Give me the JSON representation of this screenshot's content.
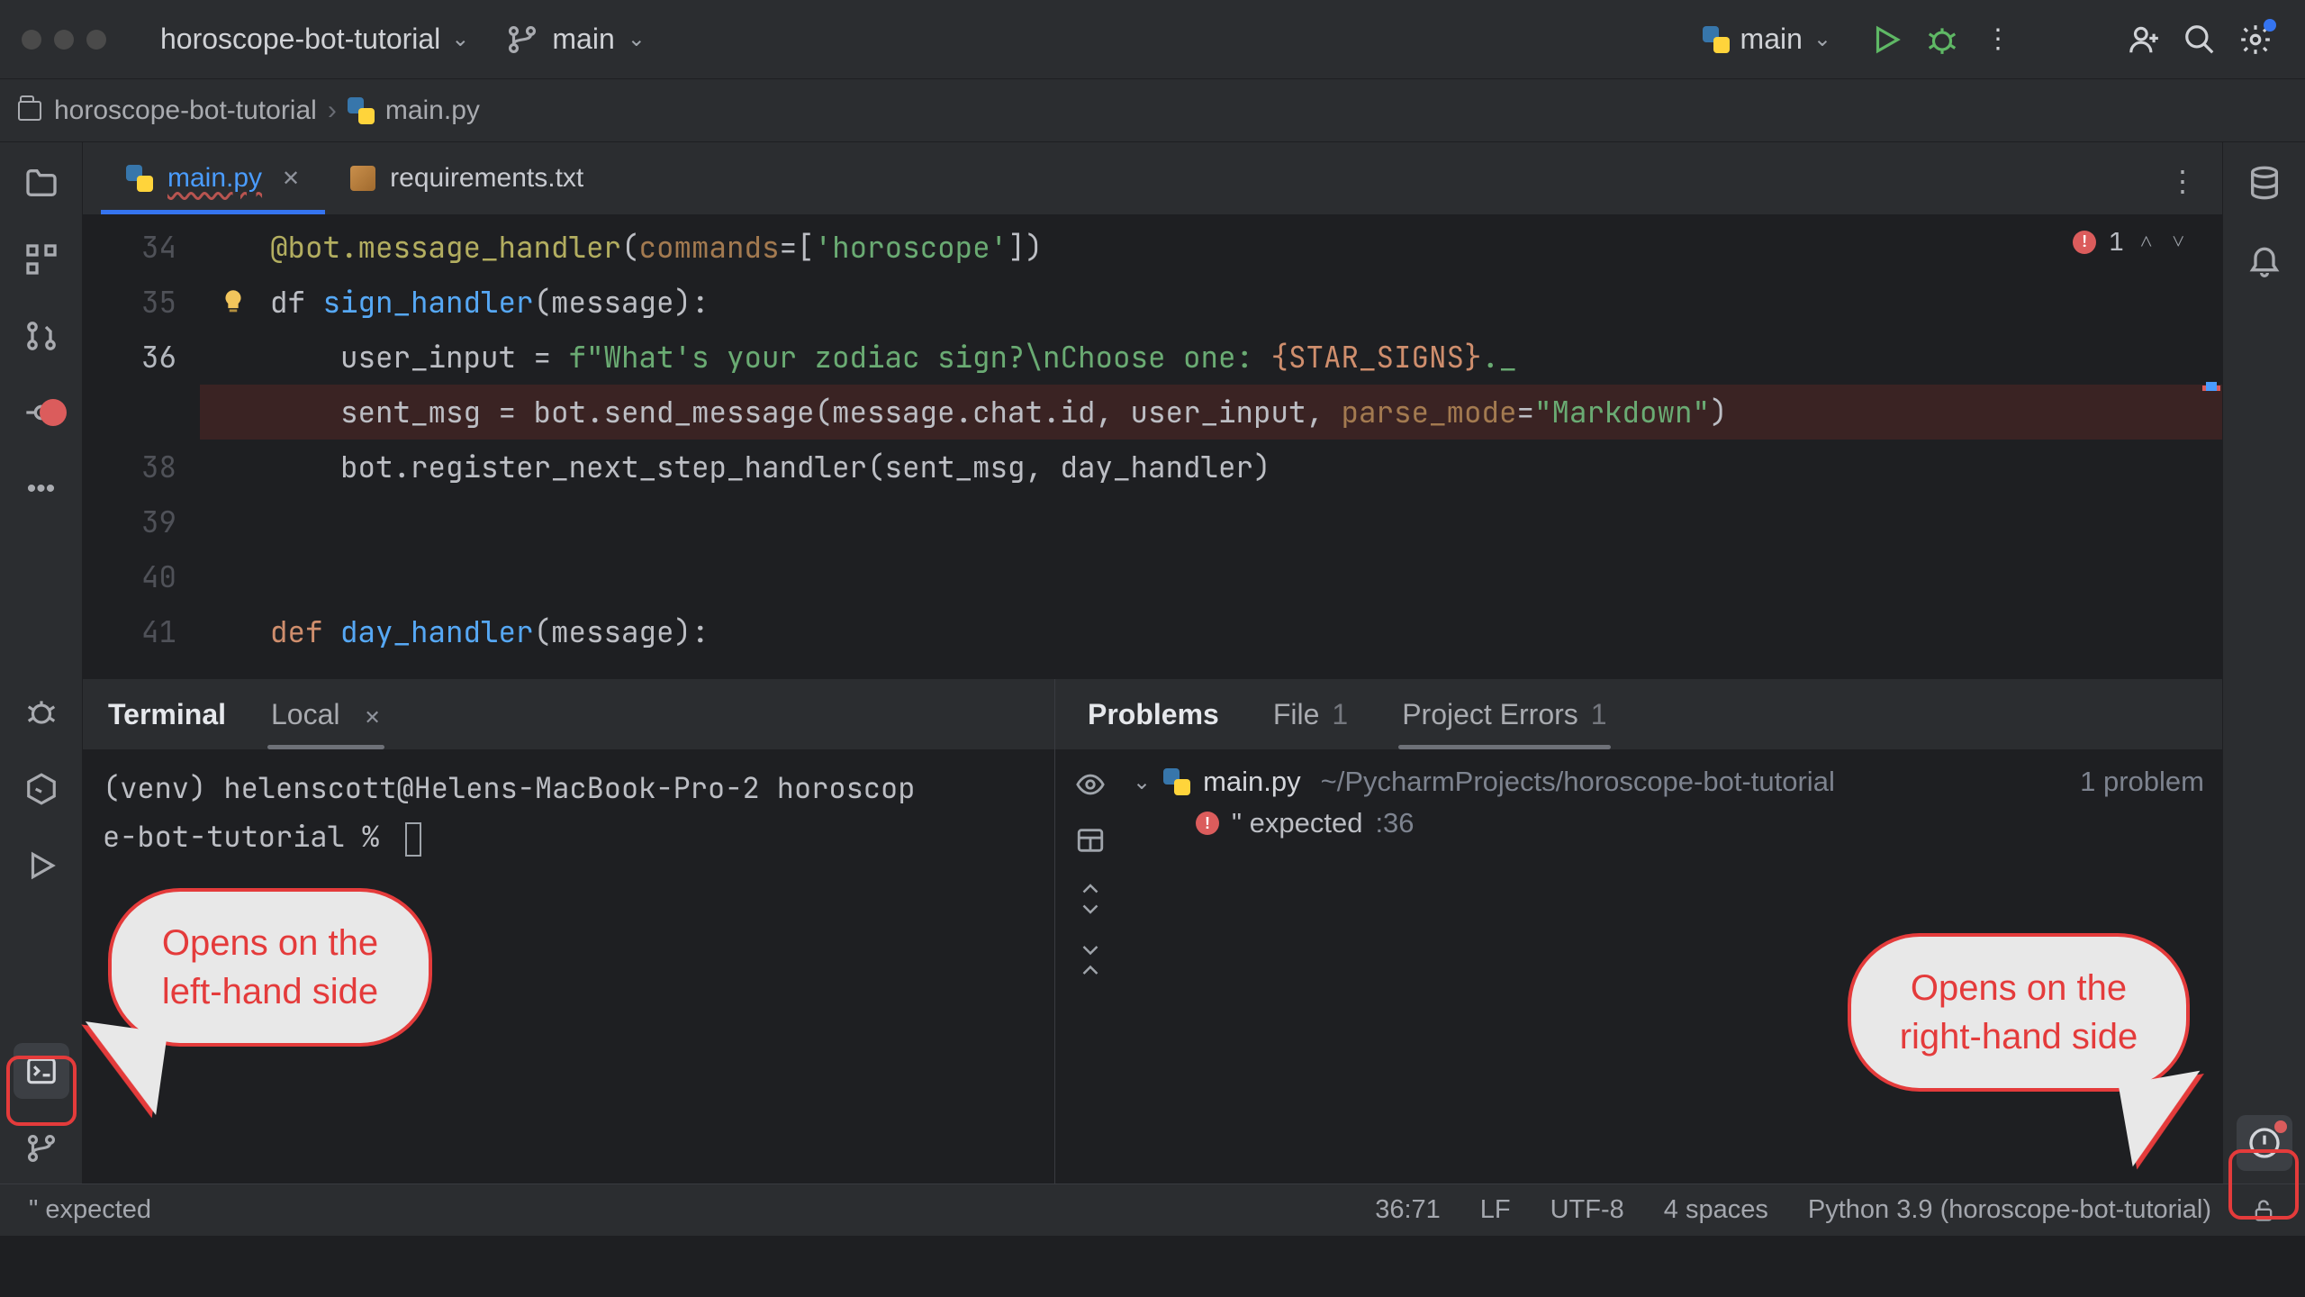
{
  "titlebar": {
    "project": "horoscope-bot-tutorial",
    "branch": "main",
    "run_config": "main"
  },
  "breadcrumb": {
    "project": "horoscope-bot-tutorial",
    "file": "main.py"
  },
  "tabs": [
    {
      "label": "main.py",
      "active": true,
      "closable": true
    },
    {
      "label": "requirements.txt",
      "active": false,
      "closable": false
    }
  ],
  "inspection": {
    "error_count": "1"
  },
  "code": {
    "lines": [
      {
        "num": "34"
      },
      {
        "num": "35"
      },
      {
        "num": "36",
        "current": true
      },
      {
        "num": "",
        "breakpoint": true
      },
      {
        "num": "38"
      },
      {
        "num": "39"
      },
      {
        "num": "40"
      },
      {
        "num": "41"
      }
    ],
    "l34_dec": "@bot.message_handler",
    "l34_arg": "commands",
    "l34_val": "'horoscope'",
    "l35_def": "def ",
    "l35_fn": "sign_handler",
    "l35_par": "(message):",
    "l36_a": "        user_input = ",
    "l36_b": "f\"What's your zodiac sign?\\nChoose one: ",
    "l36_c": "{STAR_SIGNS}",
    "l36_d": "._",
    "l37_a": "        sent_msg = bot.send_message(message.chat.id, user_input, ",
    "l37_b": "parse_mode",
    "l37_c": "=",
    "l37_d": "\"Markdown\"",
    "l37_e": ")",
    "l38": "        bot.register_next_step_handler(sent_msg, day_handler)",
    "l41_def": "def ",
    "l41_fn": "day_handler",
    "l41_par": "(message):"
  },
  "terminal": {
    "title": "Terminal",
    "tab": "Local",
    "line1": "(venv) helenscott@Helens-MacBook-Pro-2 horoscop",
    "line2": "e-bot-tutorial % "
  },
  "problems": {
    "title": "Problems",
    "file_tab": "File",
    "file_count": "1",
    "proj_tab": "Project Errors",
    "proj_count": "1",
    "file_name": "main.py",
    "file_path": "~/PycharmProjects/horoscope-bot-tutorial",
    "prob_count": "1 problem",
    "err_text": "\" expected",
    "err_line": ":36"
  },
  "status": {
    "msg": "\" expected",
    "pos": "36:71",
    "le": "LF",
    "enc": "UTF-8",
    "indent": "4 spaces",
    "interp": "Python 3.9 (horoscope-bot-tutorial)"
  },
  "callouts": {
    "left": "Opens on the left-hand side",
    "right": "Opens on the right-hand side"
  }
}
